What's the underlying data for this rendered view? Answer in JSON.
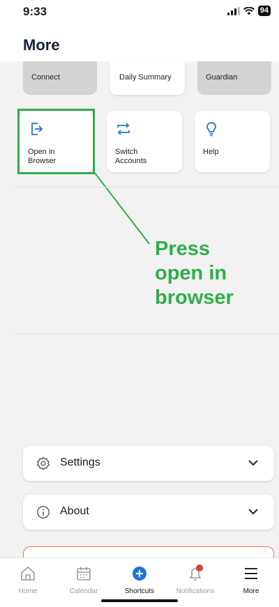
{
  "status_bar": {
    "time": "9:33",
    "battery": "94"
  },
  "header": {
    "title": "More"
  },
  "tiles_top": [
    {
      "label": "Connect"
    },
    {
      "label": "Daily Summary"
    },
    {
      "label": "Guardian"
    }
  ],
  "tiles": [
    {
      "label_line1": "Open in",
      "label_line2": "Browser",
      "icon": "open-in-browser-icon"
    },
    {
      "label_line1": "Switch",
      "label_line2": "Accounts",
      "icon": "switch-accounts-icon"
    },
    {
      "label_line1": "Help",
      "label_line2": "",
      "icon": "help-icon"
    }
  ],
  "annotation": {
    "line1": "Press",
    "line2": "open in",
    "line3": "browser",
    "color": "#2fae4a"
  },
  "accordions": [
    {
      "label": "Settings",
      "icon": "gear-icon"
    },
    {
      "label": "About",
      "icon": "info-icon"
    }
  ],
  "tabbar": [
    {
      "label": "Home",
      "icon": "home-icon",
      "active": false
    },
    {
      "label": "Calendar",
      "icon": "calendar-icon",
      "active": false
    },
    {
      "label": "Shortcuts",
      "icon": "plus-circle-icon",
      "active": true
    },
    {
      "label": "Notifications",
      "icon": "bell-icon",
      "active": false
    },
    {
      "label": "More",
      "icon": "menu-icon",
      "active": true
    }
  ],
  "colors": {
    "accent_blue": "#1f74d8",
    "notification_dot": "#e53935",
    "title_navy": "#16213a"
  }
}
